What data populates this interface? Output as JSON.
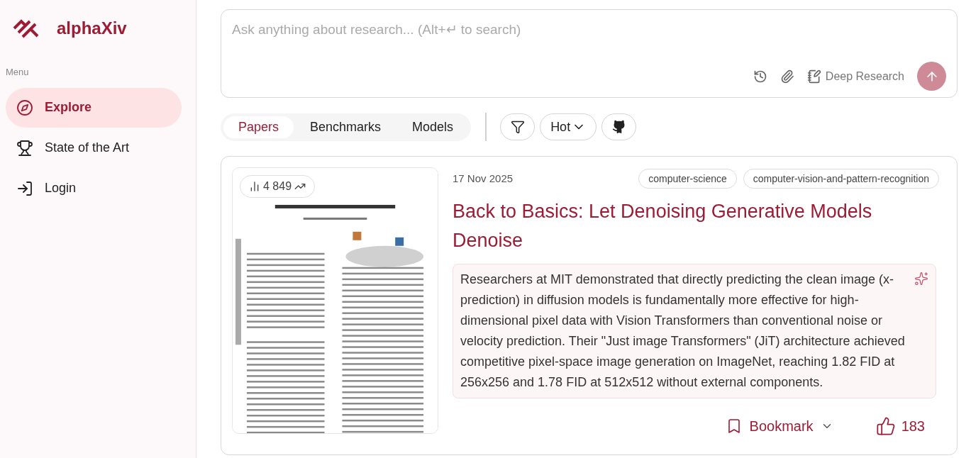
{
  "brand": {
    "name": "alphaXiv"
  },
  "sidebar": {
    "heading": "Menu",
    "items": [
      {
        "label": "Explore",
        "selected": true
      },
      {
        "label": "State of the Art",
        "selected": false
      },
      {
        "label": "Login",
        "selected": false
      }
    ]
  },
  "search": {
    "placeholder": "Ask anything about research... (Alt+↵ to search)",
    "deep_research": "Deep Research"
  },
  "tabs": [
    {
      "label": "Papers",
      "selected": true
    },
    {
      "label": "Benchmarks",
      "selected": false
    },
    {
      "label": "Models",
      "selected": false
    }
  ],
  "sort": {
    "label": "Hot"
  },
  "paper": {
    "views": "4 849",
    "date": "17 Nov 2025",
    "tags": [
      "computer-science",
      "computer-vision-and-pattern-recognition"
    ],
    "title": "Back to Basics: Let Denoising Generative Models Denoise",
    "summary": "Researchers at MIT demonstrated that directly predicting the clean image (x-prediction) in diffusion models is fundamentally more effective for high-dimensional pixel data with Vision Transformers than conventional noise or velocity prediction. Their \"Just image Transformers\" (JiT) architecture achieved competitive pixel-space image generation on ImageNet, reaching 1.82 FID at 256x256 and 1.78 FID at 512x512 without external components.",
    "bookmark": "Bookmark",
    "likes": "183"
  }
}
